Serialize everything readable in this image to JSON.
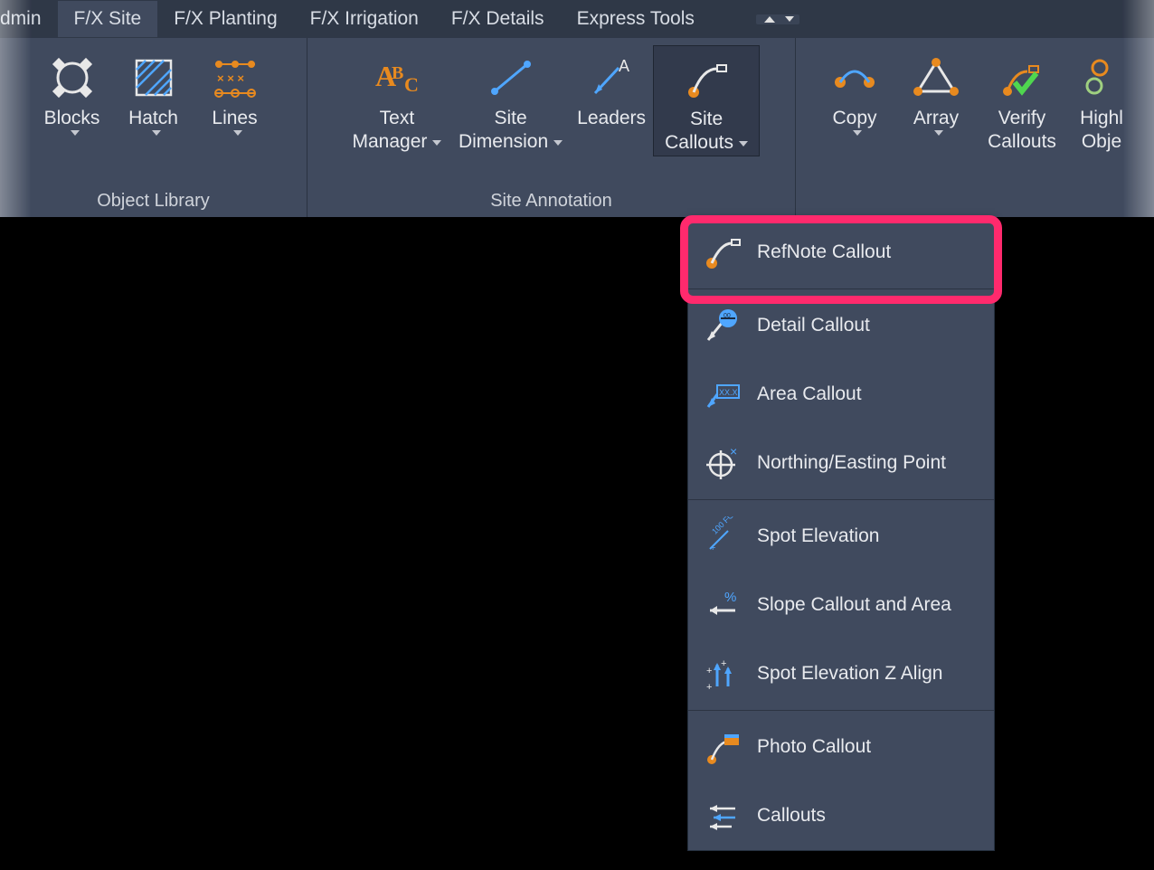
{
  "tabs": {
    "admin": "dmin",
    "fx_site": "F/X Site",
    "fx_planting": "F/X Planting",
    "fx_irrigation": "F/X Irrigation",
    "fx_details": "F/X Details",
    "express_tools": "Express Tools"
  },
  "panels": {
    "object_library": "Object Library",
    "site_annotation": "Site Annotation"
  },
  "buttons": {
    "blocks": "Blocks",
    "hatch": "Hatch",
    "lines": "Lines",
    "text_manager_l1": "Text",
    "text_manager_l2": "Manager",
    "site_dimension_l1": "Site",
    "site_dimension_l2": "Dimension",
    "leaders": "Leaders",
    "site_callouts_l1": "Site",
    "site_callouts_l2": "Callouts",
    "copy": "Copy",
    "array": "Array",
    "verify_callouts_l1": "Verify",
    "verify_callouts_l2": "Callouts",
    "highlight_l1": "Highl",
    "highlight_l2": "Obje"
  },
  "dropdown": {
    "refnote": "RefNote Callout",
    "detail": "Detail Callout",
    "area": "Area Callout",
    "northing": "Northing/Easting Point",
    "spot_elev": "Spot Elevation",
    "slope": "Slope Callout and Area",
    "spot_z": "Spot Elevation Z Align",
    "photo": "Photo Callout",
    "callouts": "Callouts"
  },
  "colors": {
    "accent_orange": "#e88a1f",
    "accent_blue": "#4fa6ff",
    "accent_green": "#4fd64f"
  }
}
